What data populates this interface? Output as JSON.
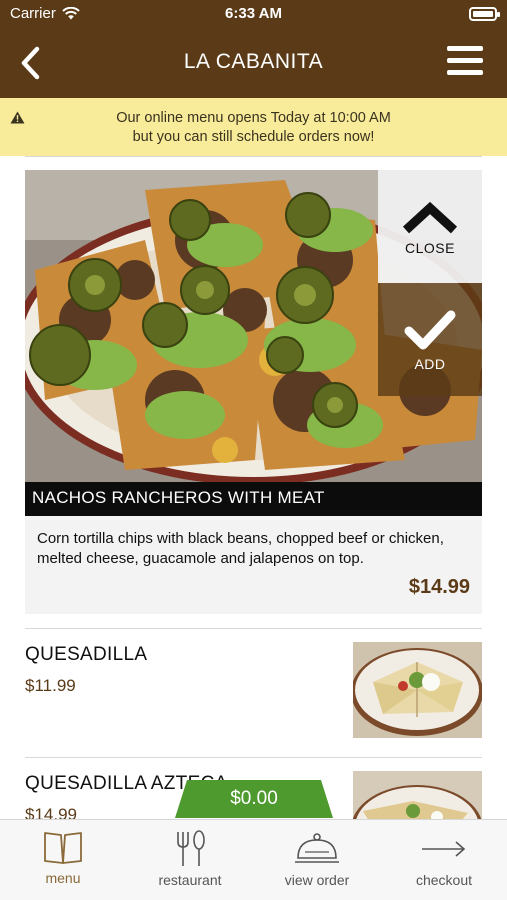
{
  "status_bar": {
    "carrier": "Carrier",
    "time": "6:33 AM"
  },
  "nav": {
    "title": "LA CABANITA",
    "back_icon": "chevron-left-icon",
    "menu_icon": "hamburger-icon"
  },
  "notice": {
    "line1": "Our online menu opens Today at 10:00 AM",
    "line2": "but you can still schedule orders now!",
    "icon": "warning-icon"
  },
  "expanded_item": {
    "name": "NACHOS RANCHEROS WITH MEAT",
    "description": "Corn tortilla chips with black beans, chopped beef or chicken, melted cheese, guacamole and jalapenos on top.",
    "price": "$14.99",
    "close_label": "CLOSE",
    "add_label": "ADD"
  },
  "menu_items": [
    {
      "name": "QUESADILLA",
      "price": "$11.99"
    },
    {
      "name": "QUESADILLA AZTECA",
      "price": "$14.99"
    }
  ],
  "cart": {
    "total": "$0.00"
  },
  "tabs": [
    {
      "label": "menu",
      "icon": "book-icon",
      "active": true
    },
    {
      "label": "restaurant",
      "icon": "fork-knife-icon",
      "active": false
    },
    {
      "label": "view order",
      "icon": "cloche-icon",
      "active": false
    },
    {
      "label": "checkout",
      "icon": "arrow-right-icon",
      "active": false
    }
  ],
  "colors": {
    "brand_brown": "#5b3b17",
    "notice_yellow": "#f8ec9a",
    "cart_green": "#4f9a2f",
    "active_tab": "#8a6a3a"
  }
}
